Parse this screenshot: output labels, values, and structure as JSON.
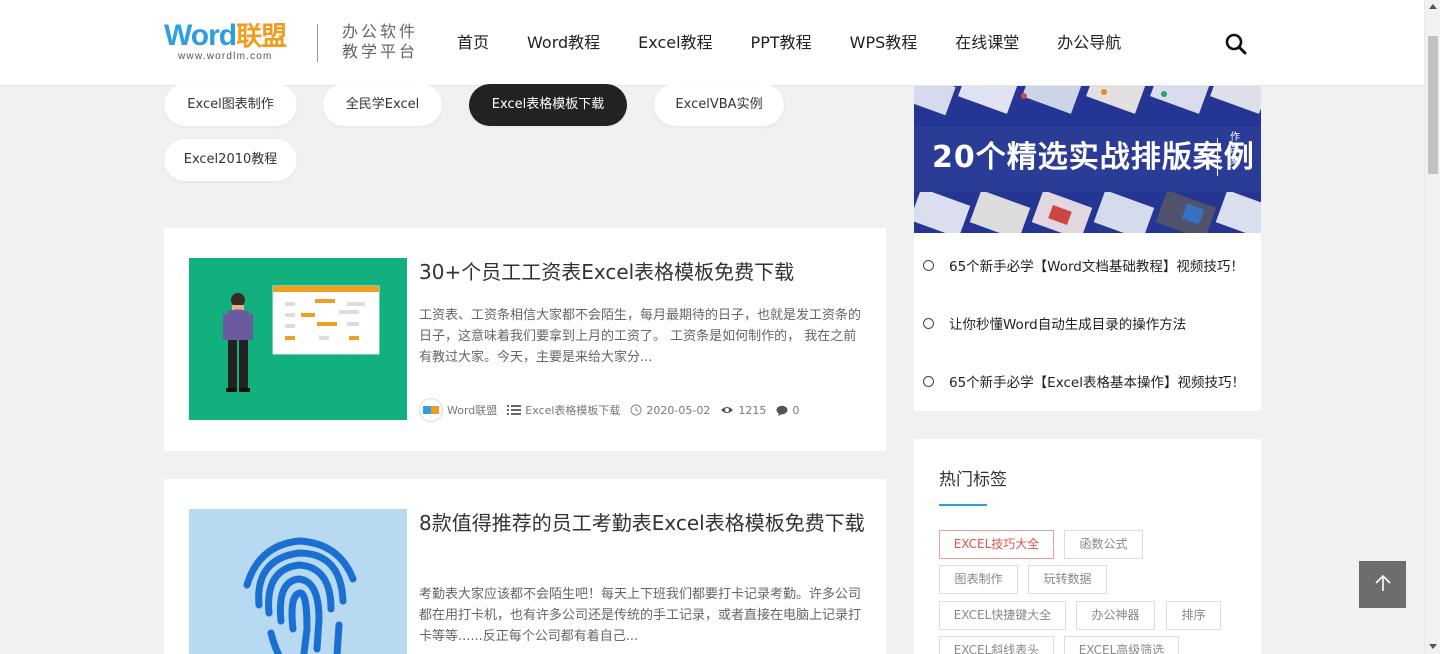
{
  "header": {
    "logo_word": "Word",
    "logo_cn": "联盟",
    "logo_domain": "www.wordlm.com",
    "slogan_line1": "办公软件",
    "slogan_line2": "教学平台",
    "nav": [
      "首页",
      "Word教程",
      "Excel教程",
      "PPT教程",
      "WPS教程",
      "在线课堂",
      "办公导航"
    ]
  },
  "categories": [
    {
      "label": "Excel图表制作",
      "active": false
    },
    {
      "label": "全民学Excel",
      "active": false
    },
    {
      "label": "Excel表格模板下载",
      "active": true
    },
    {
      "label": "ExcelVBA实例",
      "active": false
    },
    {
      "label": "Excel2010教程",
      "active": false
    }
  ],
  "articles": [
    {
      "title": "30+个员工工资表Excel表格模板免费下载",
      "excerpt": "工资表、工资条相信大家都不会陌生，每月最期待的日子，也就是发工资条的日子，这意味着我们要拿到上月的工资了。 工资条是如何制作的， 我在之前有教过大家。今天，主要是来给大家分...",
      "author": "Word联盟",
      "category": "Excel表格模板下载",
      "date": "2020-05-02",
      "views": "1215",
      "comments": "0",
      "thumb_bg": "#13b07f"
    },
    {
      "title": "8款值得推荐的员工考勤表Excel表格模板免费下载",
      "excerpt": "考勤表大家应该都不会陌生吧！每天上下班我们都要打卡记录考勤。许多公司都在用打卡机，也有许多公司还是传统的手工记录，或者直接在电脑上记录打卡等等......反正每个公司都有着自己...",
      "thumb_bg": "#b7d9f1"
    }
  ],
  "sidebar": {
    "banner_text": "20个精选实战排版案例",
    "banner_side": "作品集",
    "links": [
      "65个新手必学【Word文档基础教程】视频技巧！",
      "让你秒懂Word自动生成目录的操作方法",
      "65个新手必学【Excel表格基本操作】视频技巧！"
    ],
    "tags_title": "热门标签",
    "tags": [
      "EXCEL技巧大全",
      "函数公式",
      "图表制作",
      "玩转数据",
      "EXCEL快捷键大全",
      "办公神器",
      "排序",
      "EXCEL斜线表头",
      "EXCEL高级筛选"
    ]
  },
  "colors": {
    "brand_blue": "#2d9ee0",
    "brand_orange": "#f29c1f",
    "active_pill": "#222222",
    "hot_tag": "#e0524a"
  }
}
